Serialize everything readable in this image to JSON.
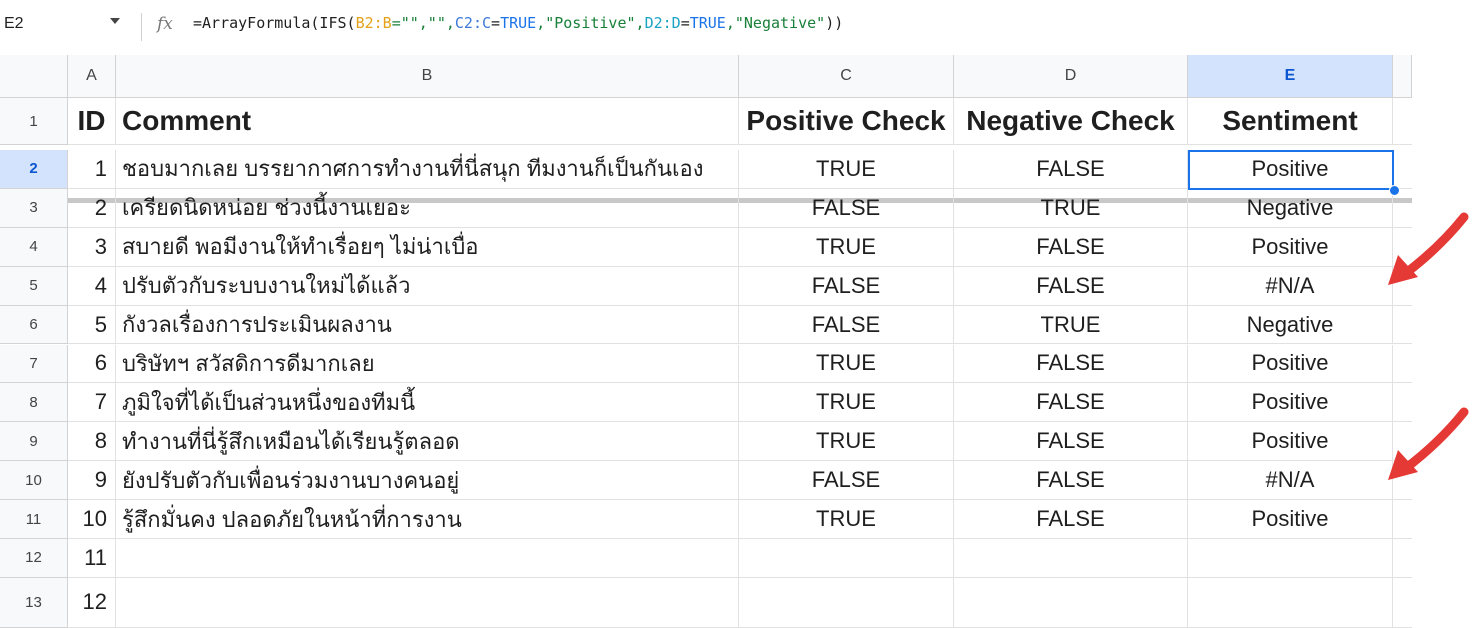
{
  "formula_bar": {
    "cell_ref": "E2",
    "fx_label": "fx",
    "formula_parts": [
      {
        "t": "=ArrayFormula(IFS(",
        "c": ""
      },
      {
        "t": "B2:B",
        "c": "f-b"
      },
      {
        "t": "=\"\",\"\",",
        "c": "f-str"
      },
      {
        "t": "C2:C",
        "c": "f-c"
      },
      {
        "t": "=",
        "c": ""
      },
      {
        "t": "TRUE",
        "c": "f-kw"
      },
      {
        "t": ",\"Positive\",",
        "c": "f-str"
      },
      {
        "t": "D2:D",
        "c": "f-d"
      },
      {
        "t": "=",
        "c": ""
      },
      {
        "t": "TRUE",
        "c": "f-kw"
      },
      {
        "t": ",\"Negative\"",
        "c": "f-str"
      },
      {
        "t": "))",
        "c": ""
      }
    ]
  },
  "columns": [
    "A",
    "B",
    "C",
    "D",
    "E"
  ],
  "selected_column": "E",
  "selected_row": "2",
  "header_row": {
    "row": "1",
    "cells": [
      "ID",
      "Comment",
      "Positive Check",
      "Negative Check",
      "Sentiment"
    ]
  },
  "rows": [
    {
      "row": "2",
      "cells": [
        "1",
        "ชอบมากเลย บรรยากาศการทำงานที่นี่สนุก ทีมงานก็เป็นกันเอง",
        "TRUE",
        "FALSE",
        "Positive"
      ]
    },
    {
      "row": "3",
      "cells": [
        "2",
        "เครียดนิดหน่อย ช่วงนี้งานเยอะ",
        "FALSE",
        "TRUE",
        "Negative"
      ]
    },
    {
      "row": "4",
      "cells": [
        "3",
        "สบายดี พอมีงานให้ทำเรื่อยๆ ไม่น่าเบื่อ",
        "TRUE",
        "FALSE",
        "Positive"
      ]
    },
    {
      "row": "5",
      "cells": [
        "4",
        "ปรับตัวกับระบบงานใหม่ได้แล้ว",
        "FALSE",
        "FALSE",
        "#N/A"
      ]
    },
    {
      "row": "6",
      "cells": [
        "5",
        "กังวลเรื่องการประเมินผลงาน",
        "FALSE",
        "TRUE",
        "Negative"
      ]
    },
    {
      "row": "7",
      "cells": [
        "6",
        "บริษัทฯ สวัสดิการดีมากเลย",
        "TRUE",
        "FALSE",
        "Positive"
      ]
    },
    {
      "row": "8",
      "cells": [
        "7",
        "ภูมิใจที่ได้เป็นส่วนหนึ่งของทีมนี้",
        "TRUE",
        "FALSE",
        "Positive"
      ]
    },
    {
      "row": "9",
      "cells": [
        "8",
        "ทำงานที่นี่รู้สึกเหมือนได้เรียนรู้ตลอด",
        "TRUE",
        "FALSE",
        "Positive"
      ]
    },
    {
      "row": "10",
      "cells": [
        "9",
        "ยังปรับตัวกับเพื่อนร่วมงานบางคนอยู่",
        "FALSE",
        "FALSE",
        "#N/A"
      ]
    },
    {
      "row": "11",
      "cells": [
        "10",
        "รู้สึกมั่นคง ปลอดภัยในหน้าที่การงาน",
        "TRUE",
        "FALSE",
        "Positive"
      ]
    },
    {
      "row": "12",
      "cells": [
        "11",
        "",
        "",
        "",
        ""
      ]
    },
    {
      "row": "13",
      "cells": [
        "12",
        "",
        "",
        "",
        ""
      ]
    }
  ],
  "annotation_color": "#e53935",
  "selection_color": "#1a73e8"
}
